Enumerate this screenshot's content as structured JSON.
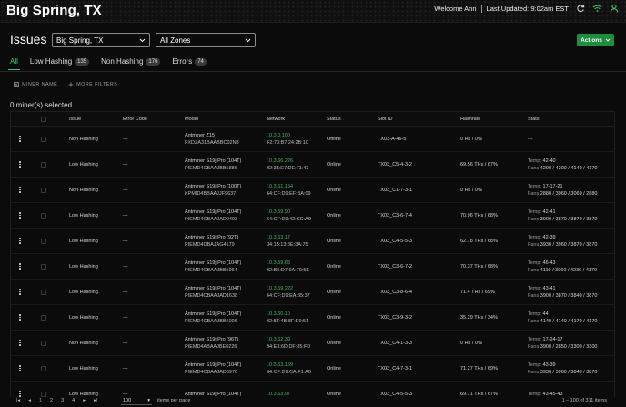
{
  "header": {
    "site_title": "Big Spring, TX",
    "welcome": "Welcome Ann",
    "last_updated": "Last Updated: 9:02am EST"
  },
  "page": {
    "title": "Issues",
    "site_select": "Big Spring, TX",
    "zone_select": "All Zones",
    "actions_label": "Actions"
  },
  "tabs": [
    {
      "label": "All",
      "count": ""
    },
    {
      "label": "Low Hashing",
      "count": "135"
    },
    {
      "label": "Non Hashing",
      "count": "176"
    },
    {
      "label": "Errors",
      "count": "74"
    }
  ],
  "filters": {
    "miner_name": "MINER NAME",
    "more_filters": "MORE FILTERS"
  },
  "selected_count": "0 miner(s) selected",
  "columns": {
    "issue": "Issue",
    "error_code": "Error Code",
    "model": "Model",
    "network": "Network",
    "status": "Status",
    "slot_id": "Slot ID",
    "hashrate": "Hashrate",
    "stats": "Stats"
  },
  "rows": [
    {
      "issue": "Non Hashing",
      "error": "---",
      "model": "Antminer Z15",
      "serial": "FXDZA31BAABBC02N8",
      "ip": "10.3.0.100",
      "mac": "F2:73:B7:24:2B:10",
      "status": "Offline",
      "slot": "TX03-A-46-5",
      "hash": "0 Hs / 0%",
      "temp": "",
      "fans": "",
      "stats_dash": "---"
    },
    {
      "issue": "Low Hashing",
      "error": "---",
      "model": "Antminer S19j Pro (104T)",
      "serial": "PIEMD4CBAAJBB5886",
      "ip": "10.3.66.226",
      "mac": "02:35:E7:DE:71:43",
      "status": "Online",
      "slot": "TX03_C5-4-3-2",
      "hash": "69.56 THs / 67%",
      "temp": "42-40",
      "fans": "4200 / 4200 / 4140 / 4170",
      "stats_dash": ""
    },
    {
      "issue": "Non Hashing",
      "error": "---",
      "model": "Antminer S19j Pro (100T)",
      "serial": "KPMID4BBAAJJF9637",
      "ip": "10.3.51.164",
      "mac": "64:CF:D9:EF:BA:09",
      "status": "Online",
      "slot": "TX03_C1-7-3-1",
      "hash": "0 Hs / 0%",
      "temp": "17-17-21",
      "fans": "2880 / 3960 / 3060 / 2880",
      "stats_dash": ""
    },
    {
      "issue": "Low Hashing",
      "error": "---",
      "model": "Antminer S19j Pro (104T)",
      "serial": "PIEMD4CBAAJAD0493",
      "ip": "10.3.59.90",
      "mac": "64:CF:D9:42:CC:A9",
      "status": "Online",
      "slot": "TX03_C3-6-7-4",
      "hash": "70.96 THs / 68%",
      "temp": "42-41",
      "fans": "3900 / 3870 / 3870 / 3870",
      "stats_dash": ""
    },
    {
      "issue": "Low Hashing",
      "error": "---",
      "model": "Antminer S19j Pro (92T)",
      "serial": "PIEMD4DBAJAG4179",
      "ip": "10.3.63.17",
      "mac": "34:15:13:8E:3A:75",
      "status": "Online",
      "slot": "TX03_C4-5-5-3",
      "hash": "62.78 THs / 68%",
      "temp": "42-39",
      "fans": "3930 / 3960 / 3870 / 3870",
      "stats_dash": ""
    },
    {
      "issue": "Low Hashing",
      "error": "---",
      "model": "Antminer S19j Pro (104T)",
      "serial": "PIEMD4CBAAJBB5964",
      "ip": "10.3.59.88",
      "mac": "02:B5:D7:9A:70:5E",
      "status": "Online",
      "slot": "TX03_C3-6-7-2",
      "hash": "70.37 THs / 68%",
      "temp": "46-43",
      "fans": "4110 / 3960 / 4230 / 4170",
      "stats_dash": ""
    },
    {
      "issue": "Low Hashing",
      "error": "---",
      "model": "Antminer S19j Pro (104T)",
      "serial": "PIEMD4CBAAJAD1638",
      "ip": "10.3.59.222",
      "mac": "64:CF:D9:EA:85:37",
      "status": "Online",
      "slot": "TX03_C3-8-6-4",
      "hash": "71.4 THs / 69%",
      "temp": "43-41",
      "fans": "3900 / 3870 / 3840 / 3870",
      "stats_dash": ""
    },
    {
      "issue": "Low Hashing",
      "error": "---",
      "model": "Antminer S19j Pro (104T)",
      "serial": "PIEMD4CBAAJBB6006",
      "ip": "10.3.60.10",
      "mac": "02:8F:4B:8F:E9:51",
      "status": "Online",
      "slot": "TX03_C3-9-3-2",
      "hash": "35.29 THs / 34%",
      "temp": "44",
      "fans": "4140 / 4140 / 4170 / 4170",
      "stats_dash": ""
    },
    {
      "issue": "Non Hashing",
      "error": "---",
      "model": "Antminer S19j Pro (96T)",
      "serial": "PIEMD4ABAAJBE0226",
      "ip": "10.3.62.39",
      "mac": "94:E3:6D:DF:85:FD",
      "status": "Online",
      "slot": "TX03_C4-1-3-3",
      "hash": "0 Hs / 0%",
      "temp": "17-24-17",
      "fans": "3900 / 2850 / 3300 / 3300",
      "stats_dash": ""
    },
    {
      "issue": "Low Hashing",
      "error": "---",
      "model": "Antminer S19j Pro (104T)",
      "serial": "PIEMD4CBAAJAD0970",
      "ip": "10.3.63.159",
      "mac": "64:CF:D9:CA:F1:A6",
      "status": "Online",
      "slot": "TX03_C4-7-3-1",
      "hash": "71.27 THs / 69%",
      "temp": "43-39",
      "fans": "3930 / 3960 / 3840 / 3870",
      "stats_dash": ""
    },
    {
      "issue": "Low Hashing",
      "error": "---",
      "model": "Antminer S19j Pro (104T)",
      "serial": "",
      "ip": "10.3.63.97",
      "mac": "",
      "status": "Online",
      "slot": "TX03_C4-5-5-3",
      "hash": "69.71 THs / 67%",
      "temp": "43-45-43",
      "fans": "",
      "stats_dash": ""
    }
  ],
  "stats_labels": {
    "temp": "Temp:",
    "fans": "Fans"
  },
  "footer": {
    "pages": [
      "1",
      "2",
      "3",
      "4"
    ],
    "page_size": "100",
    "items_per_page": "items per page",
    "range": "1 – 100 of 311 items"
  },
  "colors": {
    "accent": "#46c868",
    "ip": "#3fb85e",
    "button": "#1e8d3e",
    "background": "#0b0b0b"
  }
}
